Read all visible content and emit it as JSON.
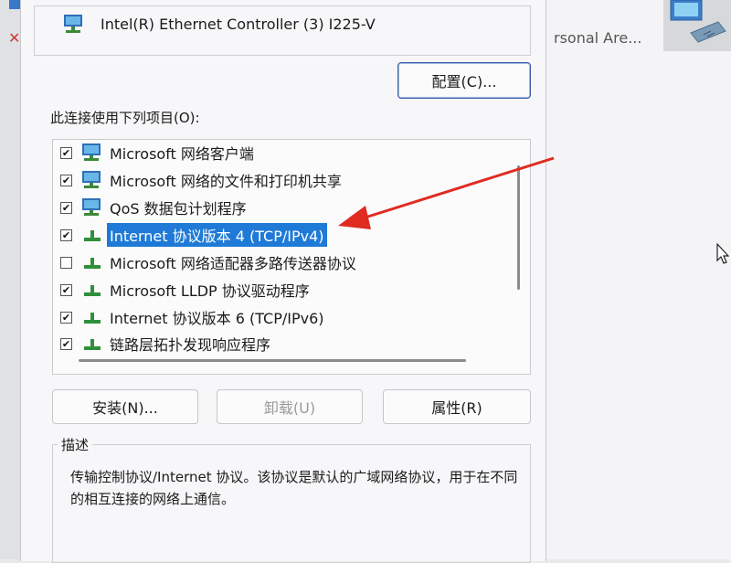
{
  "background": {
    "partial_text": "rsonal Are..."
  },
  "dialog": {
    "adapter_name": "Intel(R) Ethernet Controller (3) I225-V",
    "configure_label": "配置(C)...",
    "items_label": "此连接使用下列项目(O):",
    "items": [
      {
        "label": "Microsoft 网络客户端",
        "checked": true,
        "icon": "network-client-icon"
      },
      {
        "label": "Microsoft 网络的文件和打印机共享",
        "checked": true,
        "icon": "file-share-icon"
      },
      {
        "label": "QoS 数据包计划程序",
        "checked": true,
        "icon": "qos-icon"
      },
      {
        "label": "Internet 协议版本 4 (TCP/IPv4)",
        "checked": true,
        "icon": "protocol-icon",
        "selected": true
      },
      {
        "label": "Microsoft 网络适配器多路传送器协议",
        "checked": false,
        "icon": "protocol-icon"
      },
      {
        "label": "Microsoft LLDP 协议驱动程序",
        "checked": true,
        "icon": "protocol-icon"
      },
      {
        "label": "Internet 协议版本 6 (TCP/IPv6)",
        "checked": true,
        "icon": "protocol-icon"
      },
      {
        "label": "链路层拓扑发现响应程序",
        "checked": true,
        "icon": "protocol-icon"
      }
    ],
    "install_label": "安装(N)...",
    "uninstall_label": "卸载(U)",
    "properties_label": "属性(R)",
    "description_title": "描述",
    "description_text": "传输控制协议/Internet 协议。该协议是默认的广域网络协议，用于在不同的相互连接的网络上通信。"
  },
  "colors": {
    "selection": "#1e7ad6",
    "arrow": "#e02b20"
  }
}
